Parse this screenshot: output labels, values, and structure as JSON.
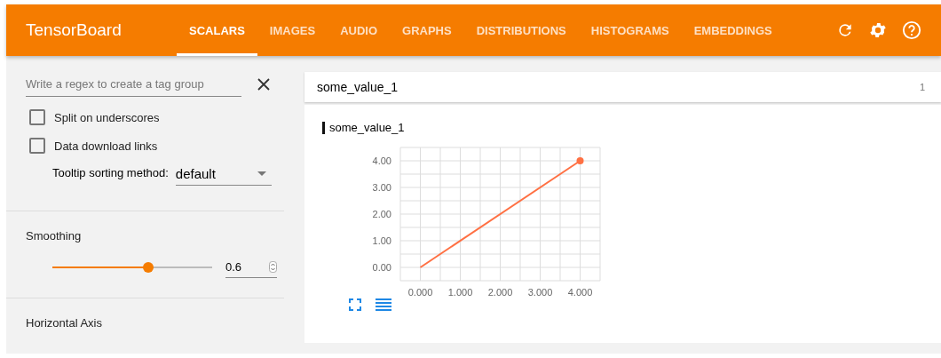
{
  "header": {
    "title": "TensorBoard",
    "tabs": [
      {
        "label": "SCALARS",
        "selected": true
      },
      {
        "label": "IMAGES",
        "selected": false
      },
      {
        "label": "AUDIO",
        "selected": false
      },
      {
        "label": "GRAPHS",
        "selected": false
      },
      {
        "label": "DISTRIBUTIONS",
        "selected": false
      },
      {
        "label": "HISTOGRAMS",
        "selected": false
      },
      {
        "label": "EMBEDDINGS",
        "selected": false
      }
    ]
  },
  "sidebar": {
    "regex_field": {
      "placeholder": "Write a regex to create a tag group"
    },
    "checkboxes": [
      {
        "label": "Split on underscores",
        "checked": false
      },
      {
        "label": "Data download links",
        "checked": false
      }
    ],
    "tooltip_sorting": {
      "label": "Tooltip sorting method:",
      "value": "default"
    },
    "smoothing": {
      "title": "Smoothing",
      "level": 0.6,
      "value": "0.6"
    },
    "horizontal_axis": {
      "title": "Horizontal Axis"
    }
  },
  "main": {
    "group": {
      "title": "some_value_1",
      "count": "1"
    },
    "card": {
      "title": "some_value_1",
      "chart_data": {
        "type": "line",
        "xlim": [
          -0.5,
          4.5
        ],
        "ylim": [
          -0.5,
          4.5
        ],
        "xticks": [
          {
            "value": 0,
            "label": "0.000"
          },
          {
            "value": 1,
            "label": "1.000"
          },
          {
            "value": 2,
            "label": "2.000"
          },
          {
            "value": 3,
            "label": "3.000"
          },
          {
            "value": 4,
            "label": "4.000"
          }
        ],
        "yticks": [
          {
            "value": 0,
            "label": "0.00"
          },
          {
            "value": 1,
            "label": "1.00"
          },
          {
            "value": 2,
            "label": "2.00"
          },
          {
            "value": 3,
            "label": "3.00"
          },
          {
            "value": 4,
            "label": "4.00"
          }
        ],
        "x": [
          0,
          4
        ],
        "grid": true,
        "series": [
          {
            "color": "#ff7043",
            "values": [
              0,
              4
            ]
          }
        ]
      }
    }
  }
}
